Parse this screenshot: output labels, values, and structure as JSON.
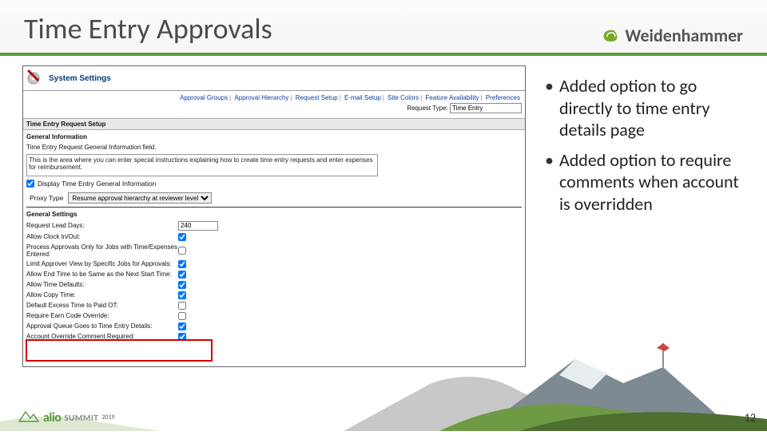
{
  "header": {
    "title": "Time Entry Approvals",
    "brand": "Weidenhammer"
  },
  "bullets": [
    "Added option to go directly to time entry details page",
    "Added option to require comments when account is overridden"
  ],
  "screenshot": {
    "system_settings": "System Settings",
    "tabs": [
      "Approval Groups",
      "Approval Hierarchy",
      "Request Setup",
      "E-mail Setup",
      "Site Colors",
      "Feature Availability",
      "Preferences"
    ],
    "request_type_label": "Request Type:",
    "request_type_value": "Time Entry",
    "sec1_title": "Time Entry Request Setup",
    "sec1_sub": "General Information",
    "sec1_fieldlabel": "Time Entry Request General Information field.",
    "sec1_textarea": "This is the area where you can enter special instructions explaining how to create time entry requests and enter expenses for reimbursement.",
    "display_checkbox_label": "Display Time Entry General Information",
    "proxy_label": "Proxy Type",
    "proxy_value": "Resume approval hierarchy at reviewer level",
    "sec2_title": "General Settings",
    "settings": [
      {
        "label": "Request Lead Days:",
        "type": "text",
        "value": "240"
      },
      {
        "label": "Allow Clock In/Out:",
        "type": "check",
        "checked": true
      },
      {
        "label": "Process Approvals Only for Jobs with Time/Expenses Entered:",
        "type": "check",
        "checked": false
      },
      {
        "label": "Limit Approver View by Specific Jobs for Approvals:",
        "type": "check",
        "checked": true
      },
      {
        "label": "Allow End Time to be Same as the Next Start Time:",
        "type": "check",
        "checked": true
      },
      {
        "label": "Allow Time Defaults:",
        "type": "check",
        "checked": true
      },
      {
        "label": "Allow Copy Time:",
        "type": "check",
        "checked": true
      },
      {
        "label": "Default Excess Time to Paid OT:",
        "type": "check",
        "checked": false
      },
      {
        "label": "Require Earn Code Override:",
        "type": "check",
        "checked": false
      },
      {
        "label": "Approval Queue Goes to Time Entry Details:",
        "type": "check",
        "checked": true
      },
      {
        "label": "Account Override Comment Required:",
        "type": "check",
        "checked": true
      }
    ]
  },
  "footer": {
    "logo_part1": "alio",
    "logo_part2": "summit",
    "logo_year": "2019",
    "pagenum": "12"
  }
}
